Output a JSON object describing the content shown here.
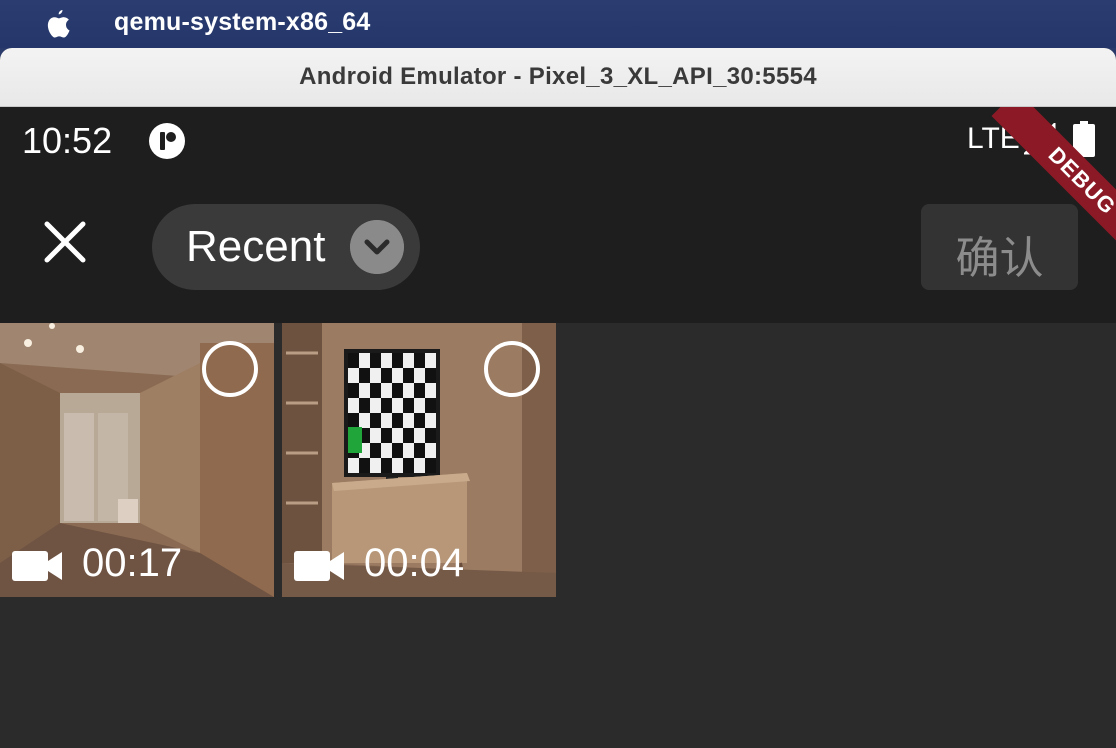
{
  "menubar": {
    "app_name": "qemu-system-x86_64"
  },
  "window": {
    "title": "Android Emulator - Pixel_3_XL_API_30:5554"
  },
  "status_bar": {
    "time": "10:52",
    "network": "LTE",
    "debug_banner": "DEBUG"
  },
  "toolbar": {
    "album_label": "Recent",
    "confirm_label": "确认"
  },
  "media": [
    {
      "type": "video",
      "duration": "00:17",
      "selected": false
    },
    {
      "type": "video",
      "duration": "00:04",
      "selected": false
    }
  ],
  "colors": {
    "debug_banner": "#8b1a26",
    "toolbar_bg": "#1e1e1e",
    "grid_bg": "#2b2b2b"
  }
}
